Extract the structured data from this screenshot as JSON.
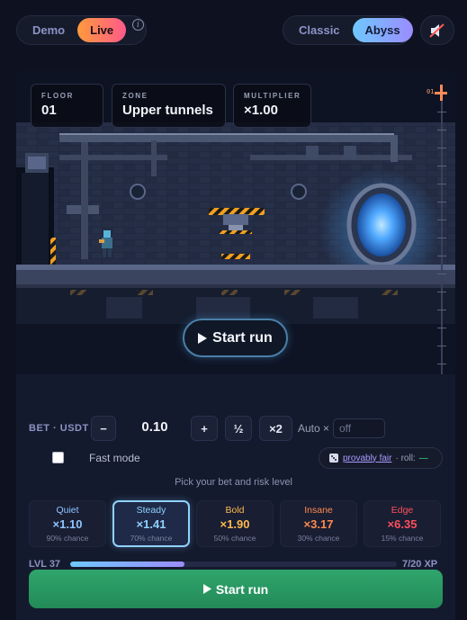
{
  "mode": {
    "demo": "Demo",
    "live": "Live",
    "info_icon": "info-icon"
  },
  "theme": {
    "classic": "Classic",
    "abyss": "Abyss"
  },
  "sound": {
    "icon": "speaker-muted-icon"
  },
  "hud": {
    "floor": {
      "label": "FLOOR",
      "value": "01"
    },
    "zone": {
      "label": "ZONE",
      "value": "Upper tunnels"
    },
    "multiplier": {
      "label": "MULTIPLIER",
      "value": "×1.00"
    },
    "depth_marker": "01"
  },
  "scene_start": {
    "label": "Start run",
    "icon": "play-icon"
  },
  "bet": {
    "label": "BET · USDT",
    "minus": "−",
    "value": "0.10",
    "plus": "+",
    "half": "½",
    "double": "×2",
    "auto_label": "Auto ×",
    "auto_placeholder": "off"
  },
  "fast_mode": {
    "label": "Fast mode",
    "checked": false
  },
  "fair": {
    "dice_icon": "dice-icon",
    "link": "provably fair",
    "roll_label": "· roll:",
    "roll_value": "—"
  },
  "hint": "Pick your bet and risk level",
  "risk_levels": [
    {
      "name": "Quiet",
      "mult": "×1.10",
      "chance": "90% chance",
      "color": "#8fc4ff",
      "selected": false
    },
    {
      "name": "Steady",
      "mult": "×1.41",
      "chance": "70% chance",
      "color": "#8fd2ff",
      "selected": true
    },
    {
      "name": "Bold",
      "mult": "×1.90",
      "chance": "50% chance",
      "color": "#ffb84d",
      "selected": false
    },
    {
      "name": "Insane",
      "mult": "×3.17",
      "chance": "30% chance",
      "color": "#ff8a4d",
      "selected": false
    },
    {
      "name": "Edge",
      "mult": "×6.35",
      "chance": "15% chance",
      "color": "#ff4f5a",
      "selected": false
    }
  ],
  "level": {
    "label": "LVL 37",
    "xp": "7/20 XP",
    "progress": 0.35
  },
  "main_start": {
    "label": "Start run",
    "icon": "play-icon"
  },
  "colors": {
    "accent_green": "#2fa56c",
    "accent_blue": "#6ec8ff",
    "accent_orange": "#ff7a4d"
  }
}
